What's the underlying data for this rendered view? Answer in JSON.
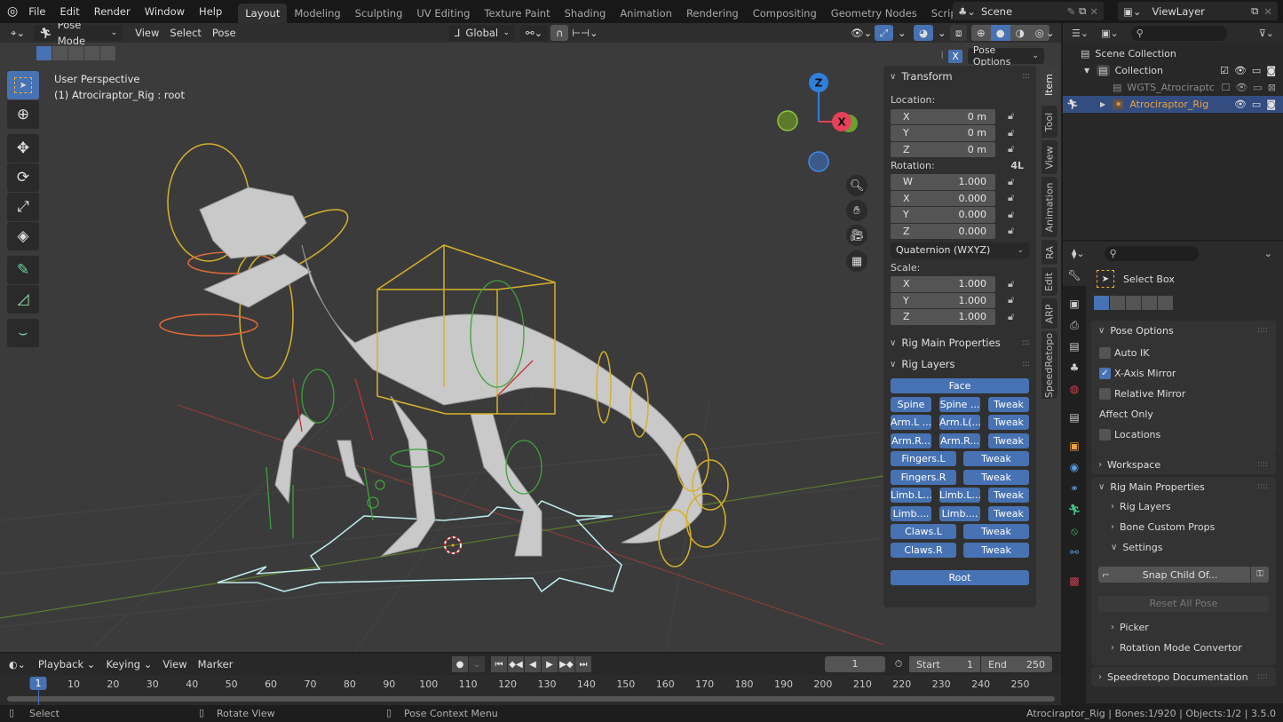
{
  "app": {
    "name": "Blender",
    "version": "3.5.0"
  },
  "menubar": {
    "items": [
      "File",
      "Edit",
      "Render",
      "Window",
      "Help"
    ],
    "workspaces": [
      "Layout",
      "Modeling",
      "Sculpting",
      "UV Editing",
      "Texture Paint",
      "Shading",
      "Animation",
      "Rendering",
      "Compositing",
      "Geometry Nodes",
      "Scripting"
    ],
    "active_workspace": "Layout",
    "add_workspace": "+",
    "scene": "Scene",
    "view_layer": "ViewLayer"
  },
  "viewport_header": {
    "mode": "Pose Mode",
    "menus": [
      "View",
      "Select",
      "Pose"
    ],
    "orientation": "Global",
    "pose_options": "Pose Options",
    "mirror_axis": "X"
  },
  "viewport": {
    "perspective_label": "User Perspective",
    "object_label": "(1) Atrociraptor_Rig : root",
    "gizmo": {
      "z": "Z",
      "x": "X"
    },
    "tools": [
      "select-box",
      "cursor",
      "move",
      "rotate",
      "scale",
      "transform",
      "annotate",
      "measure",
      "bone-roll"
    ]
  },
  "n_panel": {
    "transform_title": "Transform",
    "location_label": "Location:",
    "location": [
      {
        "axis": "X",
        "value": "0 m"
      },
      {
        "axis": "Y",
        "value": "0 m"
      },
      {
        "axis": "Z",
        "value": "0 m"
      }
    ],
    "rotation_label": "Rotation:",
    "rotation_lock_label": "4L",
    "rotation": [
      {
        "axis": "W",
        "value": "1.000"
      },
      {
        "axis": "X",
        "value": "0.000"
      },
      {
        "axis": "Y",
        "value": "0.000"
      },
      {
        "axis": "Z",
        "value": "0.000"
      }
    ],
    "rotation_mode": "Quaternion (WXYZ)",
    "scale_label": "Scale:",
    "scale": [
      {
        "axis": "X",
        "value": "1.000"
      },
      {
        "axis": "Y",
        "value": "1.000"
      },
      {
        "axis": "Z",
        "value": "1.000"
      }
    ],
    "rig_main_properties": "Rig Main Properties",
    "rig_layers": "Rig Layers",
    "layer_buttons": {
      "face": "Face",
      "rows": [
        [
          "Spine",
          "Spine ...",
          "Tweak"
        ],
        [
          "Arm.L ...",
          "Arm.L(...",
          "Tweak"
        ],
        [
          "Arm.R...",
          "Arm.R...",
          "Tweak"
        ],
        [
          "Fingers.L",
          "Tweak"
        ],
        [
          "Fingers.R",
          "Tweak"
        ],
        [
          "Limb.L...",
          "Limb.L...",
          "Tweak"
        ],
        [
          "Limb....",
          "Limb....",
          "Tweak"
        ],
        [
          "Claws.L",
          "Tweak"
        ],
        [
          "Claws.R",
          "Tweak"
        ]
      ],
      "root": "Root"
    },
    "tabs": [
      "Item",
      "Tool",
      "View",
      "Animation",
      "RA",
      "Edit",
      "ARP",
      "SpeedRetopo"
    ],
    "active_tab": "Item"
  },
  "outliner": {
    "rows": [
      {
        "label": "Scene Collection"
      },
      {
        "label": "Collection"
      },
      {
        "label": "WGTS_Atrociraptc"
      },
      {
        "label": "Atrociraptor_Rig"
      }
    ]
  },
  "properties": {
    "tool_name": "Select Box",
    "pose_options": {
      "title": "Pose Options",
      "auto_ik": {
        "label": "Auto IK",
        "checked": false
      },
      "x_axis_mirror": {
        "label": "X-Axis Mirror",
        "checked": true
      },
      "relative_mirror": {
        "label": "Relative Mirror",
        "checked": false
      },
      "affect_only": "Affect Only",
      "locations": {
        "label": "Locations",
        "checked": false
      }
    },
    "workspace": "Workspace",
    "rig_main_properties": "Rig Main Properties",
    "sub_items": [
      "Rig Layers",
      "Bone Custom Props",
      "Settings"
    ],
    "snap_child_of": "Snap Child Of...",
    "reset_all_pose": "Reset All Pose",
    "sub_items_2": [
      "Picker",
      "Rotation Mode Convertor"
    ],
    "speedretopo_docs": "Speedretopo Documentation"
  },
  "timeline": {
    "menus": [
      "Playback",
      "Keying",
      "View",
      "Marker"
    ],
    "current_frame": "1",
    "start_label": "Start",
    "start": "1",
    "end_label": "End",
    "end": "250",
    "ticks": [
      "1",
      "10",
      "20",
      "30",
      "40",
      "50",
      "60",
      "70",
      "80",
      "90",
      "100",
      "110",
      "120",
      "130",
      "140",
      "150",
      "160",
      "170",
      "180",
      "190",
      "200",
      "210",
      "220",
      "230",
      "240",
      "250"
    ]
  },
  "statusbar": {
    "hints": [
      "Select",
      "Rotate View",
      "Pose Context Menu"
    ],
    "stats": "Atrociraptor_Rig | Bones:1/920 | Objects:1/2 | 3.5.0"
  }
}
